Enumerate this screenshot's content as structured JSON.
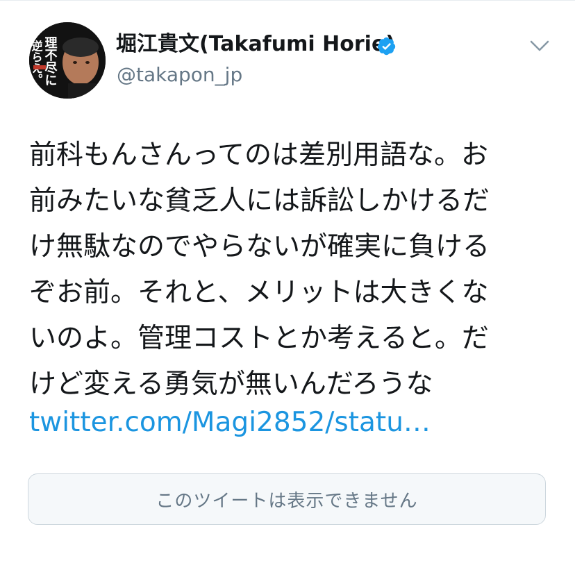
{
  "author": {
    "display_name": "堀江貴文(Takafumi Horie)",
    "handle": "@takapon_jp",
    "verified": true,
    "avatar": {
      "icon": "profile-photo",
      "cover_text_line1": "理不尽に",
      "cover_text_line2": "逆らえ。"
    }
  },
  "menu": {
    "icon": "chevron-down-icon"
  },
  "tweet": {
    "lines": [
      "前科もんさんってのは差別用語な。お",
      "前みたいな貧乏人には訴訟しかけるだ",
      "け無駄なのでやらないが確実に負ける",
      "ぞお前。それと、メリットは大きくな",
      "いのよ。管理コストとか考えると。だ",
      "けど変える勇気が無いんだろうな"
    ],
    "link": "twitter.com/Magi2852/statu…"
  },
  "quoted_tweet": {
    "unavailable_text": "このツイートは表示できません"
  },
  "colors": {
    "link": "#1b95e0",
    "verified": "#1da1f2",
    "secondary_text": "#657786",
    "quote_bg": "#f5f8fa",
    "quote_border": "#ccd6dd"
  }
}
